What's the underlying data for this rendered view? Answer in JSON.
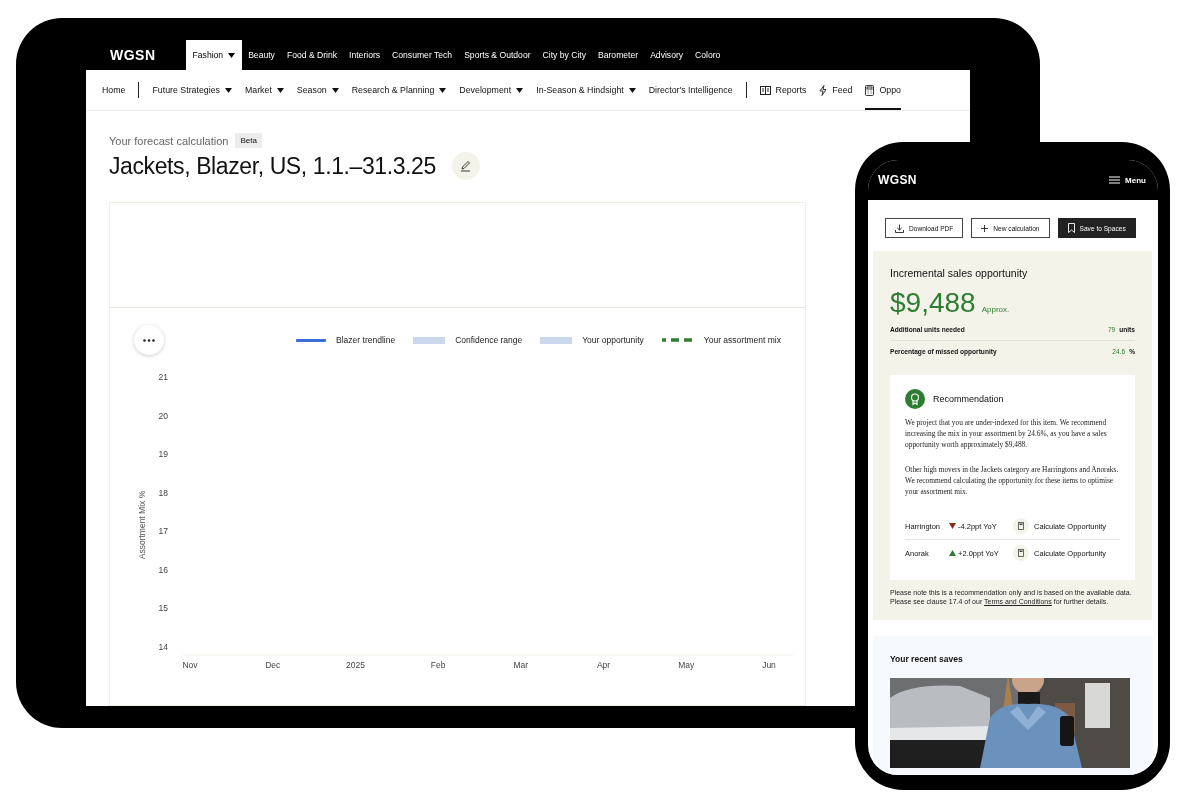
{
  "tablet": {
    "logo": "WGSN",
    "top_nav": [
      {
        "label": "Fashion",
        "selected": true,
        "dropdown": true
      },
      {
        "label": "Beauty",
        "selected": false,
        "dropdown": false
      },
      {
        "label": "Food & Drink",
        "selected": false,
        "dropdown": false
      },
      {
        "label": "Interiors",
        "selected": false,
        "dropdown": false
      },
      {
        "label": "Consumer Tech",
        "selected": false,
        "dropdown": false
      },
      {
        "label": "Sports & Outdoor",
        "selected": false,
        "dropdown": false
      },
      {
        "label": "City by City",
        "selected": false,
        "dropdown": false
      },
      {
        "label": "Barometer",
        "selected": false,
        "dropdown": false
      },
      {
        "label": "Advisory",
        "selected": false,
        "dropdown": false
      },
      {
        "label": "Coloro",
        "selected": false,
        "dropdown": false
      }
    ],
    "sub_nav": [
      {
        "kind": "link",
        "label": "Home",
        "selected": false
      },
      {
        "kind": "divider"
      },
      {
        "kind": "menu",
        "label": "Future Strategies",
        "selected": false
      },
      {
        "kind": "menu",
        "label": "Market",
        "selected": false
      },
      {
        "kind": "menu",
        "label": "Season",
        "selected": false
      },
      {
        "kind": "menu",
        "label": "Research & Planning",
        "selected": false
      },
      {
        "kind": "menu",
        "label": "Development",
        "selected": false
      },
      {
        "kind": "menu",
        "label": "In-Season & Hindsight",
        "selected": false
      },
      {
        "kind": "link",
        "label": "Director's Intelligence",
        "selected": false
      },
      {
        "kind": "divider"
      },
      {
        "kind": "icon",
        "label": "Reports",
        "selected": false
      },
      {
        "kind": "icon",
        "label": "Feed",
        "selected": false
      },
      {
        "kind": "icon",
        "label": "Oppo",
        "selected": true
      }
    ],
    "eyebrow": "Your forecast calculation",
    "badge": "Beta",
    "title": "Jackets, Blazer, US, 1.1.–31.3.25",
    "legend": [
      {
        "label": "Blazer trendline",
        "kind": "line",
        "color": "#3a6fd8"
      },
      {
        "label": "Confidence range",
        "kind": "band",
        "color": "#c9d8ea"
      },
      {
        "label": "Your opportunity",
        "kind": "band",
        "color": "#c9d8ea"
      },
      {
        "label": "Your assortment mix",
        "kind": "dashed",
        "color": "#2e7d32"
      }
    ],
    "chart_data": {
      "type": "line",
      "ylabel": "Assortment Mix %",
      "categories": [
        "Nov",
        "Dec",
        "2025",
        "Feb",
        "Mar",
        "Apr",
        "May",
        "Jun"
      ],
      "ylim": [
        14,
        21
      ],
      "yticks": [
        14,
        15,
        16,
        17,
        18,
        19,
        20,
        21
      ]
    }
  },
  "phone": {
    "logo": "WGSN",
    "menu": "Menu",
    "buttons": [
      {
        "label": "Download PDF",
        "kind": "download"
      },
      {
        "label": "New calculation",
        "kind": "new"
      },
      {
        "label": "Save to Spaces",
        "kind": "save"
      }
    ],
    "summary": {
      "title": "Incremental sales opportunity",
      "amount": "$9,488",
      "amount_note": "Approx.",
      "rows": [
        {
          "label": "Additional units needed",
          "value": "79",
          "unit": "units"
        },
        {
          "label": "Percentage of missed opportunity",
          "value": "24.6",
          "unit": "%"
        }
      ]
    },
    "recommendation": {
      "title": "Recommendation",
      "paragraphs": [
        "We project that you are under-indexed for this item. We recommend increasing the mix in your assortment by 24.6%, as you have a sales opportunity worth approximately $9,488.",
        "Other high movers in the Jackets category are Harringtons and Anoraks. We recommend calculating the opportunity for these items to optimise your assortment mix."
      ],
      "items": [
        {
          "name": "Harrington",
          "kind": "down",
          "change": "-4.2ppt YoY",
          "action": "Calculate Opportunity"
        },
        {
          "name": "Anorak",
          "kind": "up",
          "change": "+2.0ppt YoY",
          "action": "Calculate Opportunity"
        }
      ]
    },
    "note": {
      "before": "Please note this is a recommendation only and is based on the available data. Please see clause 17.4 of our ",
      "link": "Terms and Conditions",
      "after": " for further details."
    },
    "saves_title": "Your recent saves"
  }
}
